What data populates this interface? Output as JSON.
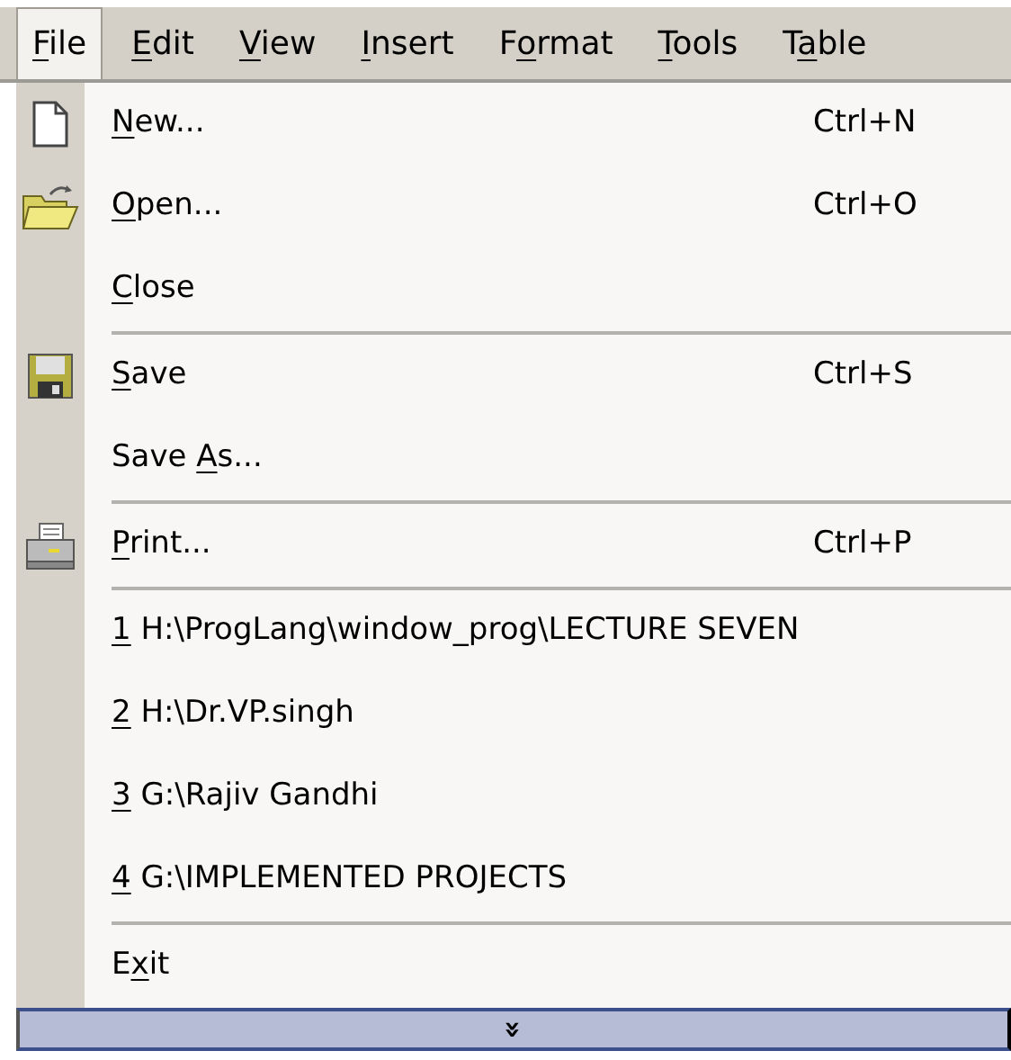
{
  "menu_bar": [
    {
      "key": "F",
      "post": "ile",
      "selected": true
    },
    {
      "key": "E",
      "post": "dit",
      "selected": false
    },
    {
      "key": "V",
      "post": "iew",
      "selected": false
    },
    {
      "key": "I",
      "post": "nsert",
      "selected": false
    },
    {
      "pre": "F",
      "key": "o",
      "post": "rmat",
      "selected": false
    },
    {
      "key": "T",
      "post": "ools",
      "selected": false
    },
    {
      "pre": "T",
      "key": "a",
      "post": "ble",
      "selected": false
    }
  ],
  "file_menu": {
    "items": [
      {
        "kind": "item",
        "key": "N",
        "post": "ew...",
        "shortcut": "Ctrl+N"
      },
      {
        "kind": "item",
        "key": "O",
        "post": "pen...",
        "shortcut": "Ctrl+O"
      },
      {
        "kind": "item",
        "key": "C",
        "post": "lose"
      },
      {
        "kind": "separator"
      },
      {
        "kind": "item",
        "key": "S",
        "post": "ave",
        "shortcut": "Ctrl+S"
      },
      {
        "kind": "item",
        "pre": "Save ",
        "key": "A",
        "post": "s..."
      },
      {
        "kind": "separator"
      },
      {
        "kind": "item",
        "key": "P",
        "post": "rint...",
        "shortcut": "Ctrl+P"
      },
      {
        "kind": "separator"
      },
      {
        "kind": "item",
        "key": "1",
        "post": " H:\\ProgLang\\window_prog\\LECTURE SEVEN"
      },
      {
        "kind": "item",
        "key": "2",
        "post": " H:\\Dr.VP.singh"
      },
      {
        "kind": "item",
        "key": "3",
        "post": " G:\\Rajiv Gandhi"
      },
      {
        "kind": "item",
        "key": "4",
        "post": " G:\\IMPLEMENTED PROJECTS"
      },
      {
        "kind": "separator"
      },
      {
        "kind": "item",
        "pre": "E",
        "key": "x",
        "post": "it"
      }
    ],
    "expand_arrow": "»"
  }
}
